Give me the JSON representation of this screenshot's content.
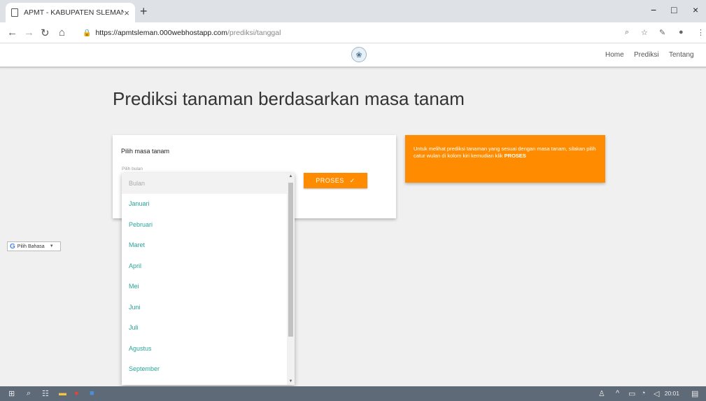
{
  "browser": {
    "tab_title": "APMT - KABUPATEN SLEMAN",
    "tab_close": "×",
    "new_tab": "+",
    "url_host": "https://apmtsleman.000webhostapp.com",
    "url_path": "/prediksi/tanggal",
    "window_controls": [
      "−",
      "□",
      "×"
    ]
  },
  "site_nav": {
    "links": [
      "Home",
      "Prediksi",
      "Tentang"
    ]
  },
  "page": {
    "heading": "Prediksi tanaman berdasarkan masa tanam"
  },
  "form": {
    "card_label": "Pilih masa tanam",
    "field_label": "Pilih bulan",
    "button_label": "PROSES",
    "button_icon": "check-icon"
  },
  "dropdown": {
    "placeholder": "Bulan",
    "options": [
      "Januari",
      "Pebruari",
      "Maret",
      "April",
      "Mei",
      "Juni",
      "Juli",
      "Agustus",
      "September"
    ]
  },
  "info_box": {
    "text": "Untuk melihat prediksi tanaman yang sesuai dengan masa tanam, silakan pilih catur wulan di kolom kiri kemudian klik",
    "emphasis": "PROSES"
  },
  "translate_widget": {
    "label": "Pilih Bahasa",
    "arrow": "▼"
  },
  "taskbar": {
    "time": "20:01"
  },
  "colors": {
    "accent": "#ff8c00",
    "option_text": "#26a69a"
  }
}
